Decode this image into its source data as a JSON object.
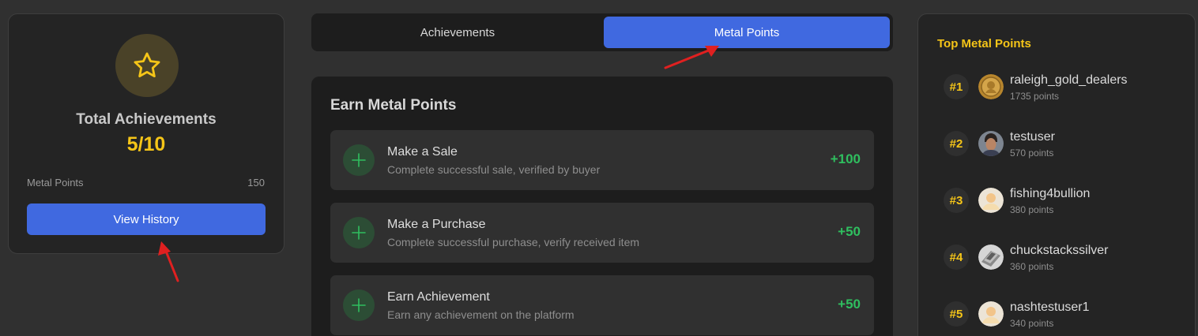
{
  "summary": {
    "title": "Total Achievements",
    "value": "5/10",
    "metal_points_label": "Metal Points",
    "metal_points_value": "150",
    "history_button": "View History",
    "icon": "star-icon"
  },
  "tabs": [
    {
      "label": "Achievements",
      "active": false
    },
    {
      "label": "Metal Points",
      "active": true
    }
  ],
  "earn": {
    "title": "Earn Metal Points",
    "items": [
      {
        "name": "Make a Sale",
        "description": "Complete successful sale, verified by buyer",
        "points": "+100",
        "icon": "plus-icon"
      },
      {
        "name": "Make a Purchase",
        "description": "Complete successful purchase, verify received item",
        "points": "+50",
        "icon": "plus-icon"
      },
      {
        "name": "Earn Achievement",
        "description": "Earn any achievement on the platform",
        "points": "+50",
        "icon": "plus-icon"
      }
    ]
  },
  "leaderboard": {
    "title": "Top Metal Points",
    "entries": [
      {
        "rank": "#1",
        "name": "raleigh_gold_dealers",
        "points": "1735 points",
        "avatar": "gold-coin-avatar"
      },
      {
        "rank": "#2",
        "name": "testuser",
        "points": "570 points",
        "avatar": "person-photo-avatar"
      },
      {
        "rank": "#3",
        "name": "fishing4bullion",
        "points": "380 points",
        "avatar": "default-avatar"
      },
      {
        "rank": "#4",
        "name": "chuckstackssilver",
        "points": "360 points",
        "avatar": "silver-bars-avatar"
      },
      {
        "rank": "#5",
        "name": "nashtestuser1",
        "points": "340 points",
        "avatar": "default-avatar"
      }
    ]
  },
  "colors": {
    "accent_blue": "#4069e0",
    "gold": "#f5c518",
    "green": "#2fbf5f",
    "arrow_red": "#e02020"
  }
}
